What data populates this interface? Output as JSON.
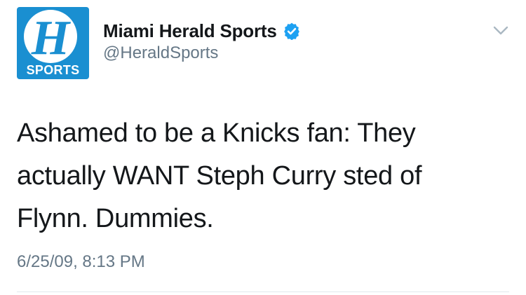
{
  "account": {
    "display_name": "Miami Herald Sports",
    "handle": "@HeraldSports",
    "verified": true,
    "avatar": {
      "letter": "H",
      "label": "SPORTS",
      "bg_color": "#1a8fd1"
    }
  },
  "tweet": {
    "lines": [
      "Ashamed to be a Knicks fan: They",
      "actually WANT Steph Curry sted of",
      "Flynn. Dummies."
    ],
    "timestamp": "6/25/09, 8:13 PM"
  },
  "icons": {
    "verified": "verified-badge-icon",
    "menu": "chevron-down-icon"
  },
  "colors": {
    "text_primary": "#14171a",
    "text_secondary": "#657786",
    "verified_blue": "#1da1f2",
    "divider": "#e1e8ed"
  }
}
